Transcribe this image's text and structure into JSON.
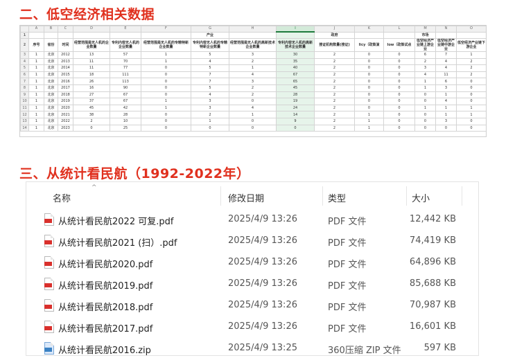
{
  "titles": {
    "section1": "二、低空经济相关数据",
    "section2": "三、从统计看民航（1992-2022年）"
  },
  "sheet": {
    "col_letters": [
      "",
      "A",
      "B",
      "C",
      "D",
      "E",
      "F",
      "G",
      "H",
      "I",
      "J",
      "K",
      "L",
      "M",
      "N",
      "O"
    ],
    "group_row": [
      "1",
      "",
      "",
      "",
      "",
      "",
      "",
      "产业",
      "",
      "",
      "政府",
      "",
      "",
      "市场",
      "",
      ""
    ],
    "header_row": [
      "2",
      "序号",
      "省份",
      "时间",
      "经营范围是无人机的企业数量",
      "专利内容无人机的企业数量",
      "经营范围是无人机的专精特新企业数量",
      "专利内容无人机的专精特新企业数量",
      "经营范围是无人机的高新技术企业数量",
      "专利内容无人机的高新技术企业数量",
      "搜证机构数量(搜证)",
      "licy（政策演",
      "low（政策试点",
      "低空经济产业链上游企业",
      "低空经济产业链中游企业",
      "低空经济产业链下游企业"
    ],
    "rows": [
      [
        "3",
        "1",
        "北京",
        "2012",
        "13",
        "57",
        "1",
        "5",
        "3",
        "30",
        "2",
        "0",
        "0",
        "6",
        "7",
        "1"
      ],
      [
        "4",
        "1",
        "北京",
        "2013",
        "11",
        "70",
        "1",
        "4",
        "2",
        "35",
        "2",
        "0",
        "0",
        "2",
        "4",
        "2"
      ],
      [
        "5",
        "1",
        "北京",
        "2014",
        "11",
        "77",
        "0",
        "5",
        "1",
        "40",
        "2",
        "0",
        "0",
        "3",
        "4",
        "2"
      ],
      [
        "6",
        "1",
        "北京",
        "2015",
        "18",
        "111",
        "0",
        "7",
        "4",
        "67",
        "2",
        "0",
        "0",
        "4",
        "11",
        "2"
      ],
      [
        "7",
        "1",
        "北京",
        "2016",
        "26",
        "113",
        "0",
        "7",
        "3",
        "65",
        "2",
        "0",
        "0",
        "1",
        "6",
        "0"
      ],
      [
        "8",
        "1",
        "北京",
        "2017",
        "16",
        "90",
        "0",
        "5",
        "2",
        "45",
        "2",
        "0",
        "0",
        "1",
        "3",
        "0"
      ],
      [
        "9",
        "1",
        "北京",
        "2018",
        "27",
        "67",
        "0",
        "4",
        "2",
        "28",
        "2",
        "0",
        "0",
        "0",
        "1",
        "0"
      ],
      [
        "10",
        "1",
        "北京",
        "2019",
        "37",
        "67",
        "1",
        "3",
        "0",
        "19",
        "2",
        "0",
        "0",
        "0",
        "4",
        "0"
      ],
      [
        "11",
        "1",
        "北京",
        "2020",
        "45",
        "42",
        "1",
        "3",
        "4",
        "24",
        "2",
        "0",
        "0",
        "1",
        "1",
        "1"
      ],
      [
        "12",
        "1",
        "北京",
        "2021",
        "38",
        "28",
        "0",
        "2",
        "1",
        "14",
        "2",
        "1",
        "0",
        "0",
        "1",
        "1"
      ],
      [
        "13",
        "1",
        "北京",
        "2022",
        "2",
        "10",
        "0",
        "1",
        "0",
        "9",
        "2",
        "1",
        "0",
        "0",
        "3",
        "0"
      ],
      [
        "14",
        "1",
        "北京",
        "2023",
        "0",
        "25",
        "0",
        "0",
        "0",
        "0",
        "2",
        "1",
        "0",
        "0",
        "0",
        "0"
      ]
    ]
  },
  "explorer": {
    "columns": {
      "name": "名称",
      "date": "修改日期",
      "type": "类型",
      "size": "大小"
    },
    "files": [
      {
        "name": "从统计看民航2022 可复.pdf",
        "date": "2025/4/9 13:26",
        "type": "PDF 文件",
        "size": "12,442 KB",
        "icon": "pdf-icon"
      },
      {
        "name": "从统计看民航2021 (扫）.pdf",
        "date": "2025/4/9 13:26",
        "type": "PDF 文件",
        "size": "74,419 KB",
        "icon": "pdf-icon"
      },
      {
        "name": "从统计看民航2020.pdf",
        "date": "2025/4/9 13:26",
        "type": "PDF 文件",
        "size": "64,896 KB",
        "icon": "pdf-icon"
      },
      {
        "name": "从统计看民航2019.pdf",
        "date": "2025/4/9 13:26",
        "type": "PDF 文件",
        "size": "85,688 KB",
        "icon": "pdf-icon"
      },
      {
        "name": "从统计看民航2018.pdf",
        "date": "2025/4/9 13:26",
        "type": "PDF 文件",
        "size": "70,987 KB",
        "icon": "pdf-icon"
      },
      {
        "name": "从统计看民航2017.pdf",
        "date": "2025/4/9 13:26",
        "type": "PDF 文件",
        "size": "16,601 KB",
        "icon": "pdf-icon"
      },
      {
        "name": "从统计看民航2016.zip",
        "date": "2025/4/9 13:25",
        "type": "360压缩 ZIP 文件",
        "size": "597 KB",
        "icon": "zip-icon"
      }
    ]
  },
  "colors": {
    "title": "#e0301e",
    "pdf_band": "#d9302c",
    "selected_column": "#e6f4ea"
  }
}
